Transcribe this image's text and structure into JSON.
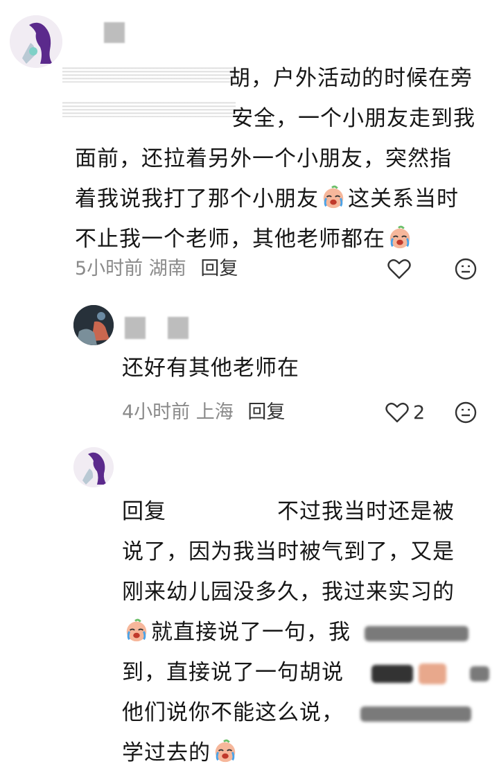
{
  "comment1": {
    "lines": [
      "胡，户外活动的时候在旁",
      "安全，一个小朋友走到我",
      "面前，还拉着另外一个小朋友，突然指",
      "着我说我打了那个小朋友",
      "这关系当时",
      "不止我一个老师，其他老师都在"
    ],
    "time": "5小时前",
    "location": "湖南",
    "reply_label": "回复",
    "icons": [
      "heart-icon",
      "smiley-icon"
    ]
  },
  "comment2": {
    "text": "还好有其他老师在",
    "time": "4小时前",
    "location": "上海",
    "reply_label": "回复",
    "like_count": "2",
    "icons": [
      "heart-icon",
      "smiley-icon"
    ]
  },
  "comment3": {
    "reply_prefix": "回复",
    "line1_suffix": "不过我当时还是被",
    "line2": "说了，因为我当时被气到了，又是",
    "line3": "刚来幼儿园没多久，我过来实习的",
    "line4": "就直接说了一句，我",
    "line5": "到，直接说了一句胡说",
    "line6": "他们说你不能这么说，",
    "line7": "学过去的"
  },
  "colors": {
    "avatar_bg": "#f3eef4",
    "avatar_hair": "#5b2a8c",
    "emoji_face": "#f6b79b",
    "tear": "#4aa3e8"
  }
}
